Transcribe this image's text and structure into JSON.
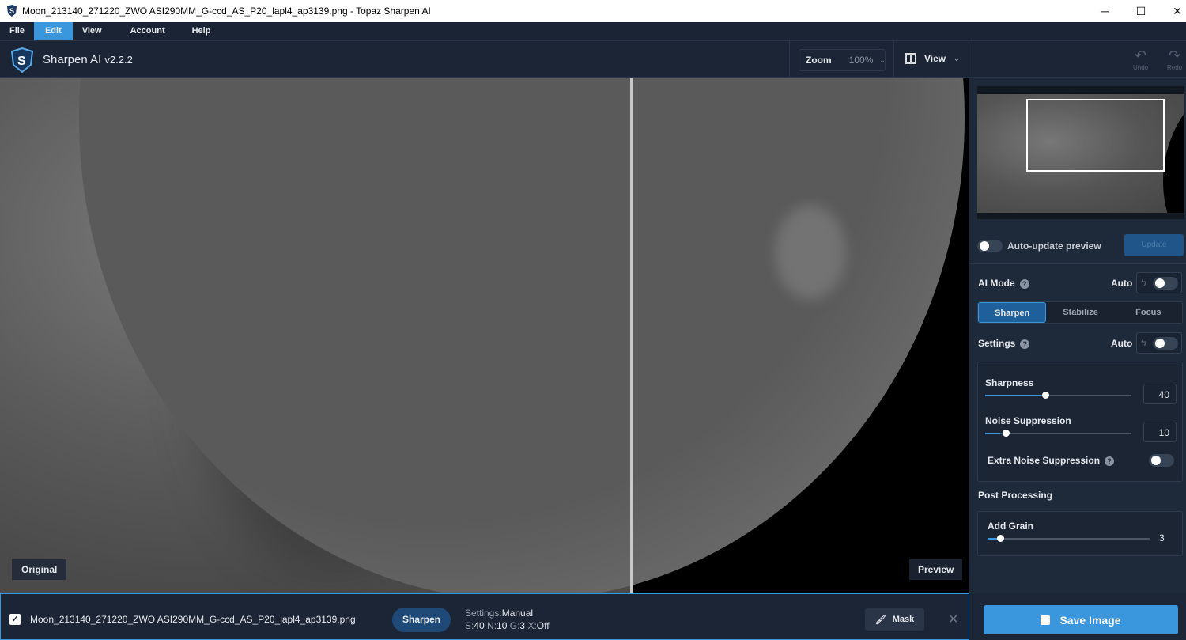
{
  "window": {
    "title": "Moon_213140_271220_ZWO ASI290MM_G-ccd_AS_P20_lapl4_ap3139.png - Topaz Sharpen AI",
    "minimize": "─",
    "maximize": "☐",
    "close": "✕"
  },
  "menu": [
    "File",
    "Edit",
    "View",
    "Account",
    "Help"
  ],
  "header": {
    "app_name": "Sharpen AI",
    "version": "v2.2.2",
    "zoom_label": "Zoom",
    "zoom_value": "100%",
    "view_label": "View",
    "undo": "Undo",
    "redo": "Redo"
  },
  "canvas": {
    "original_label": "Original",
    "preview_label": "Preview"
  },
  "panel": {
    "auto_update": "Auto-update preview",
    "update": "Update",
    "ai_mode": "AI Mode",
    "auto": "Auto",
    "modes": [
      "Sharpen",
      "Stabilize",
      "Focus"
    ],
    "settings": "Settings",
    "sharpness": "Sharpness",
    "sharpness_value": "40",
    "noise": "Noise Suppression",
    "noise_value": "10",
    "extra_noise": "Extra Noise Suppression",
    "post": "Post Processing",
    "grain": "Add Grain",
    "grain_value": "3",
    "save": "Save Image"
  },
  "bottom": {
    "filename": "Moon_213140_271220_ZWO ASI290MM_G-ccd_AS_P20_lapl4_ap3139.png",
    "mode": "Sharpen",
    "settings_label": "Settings:",
    "settings_value": "Manual",
    "s_label": "S:",
    "s_val": "40",
    "n_label": "N:",
    "n_val": "10",
    "g_label": "G:",
    "g_val": "3",
    "x_label": "X:",
    "x_val": "Off",
    "mask": "Mask",
    "remove": "✕"
  },
  "colors": {
    "accent": "#3a96dd",
    "panel": "#1e2939"
  }
}
